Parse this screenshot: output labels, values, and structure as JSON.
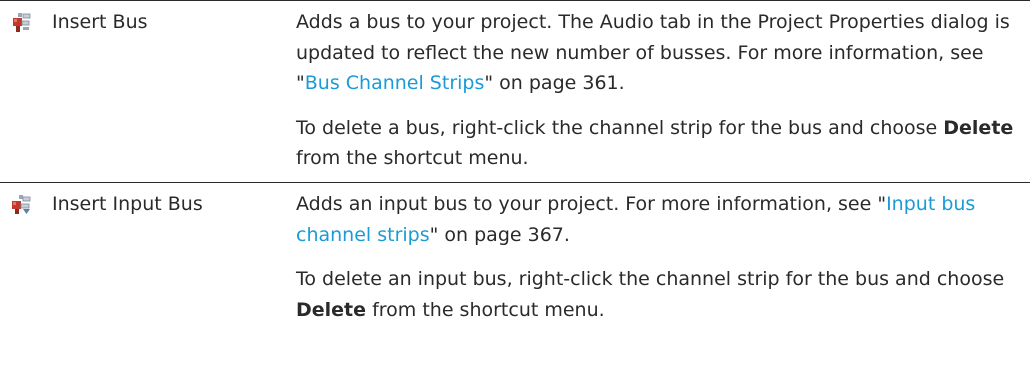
{
  "rows": [
    {
      "icon": "insert-bus-icon",
      "name": "Insert Bus",
      "para1": {
        "before": "Adds a bus to your project. The Audio tab in the Project Properties dialog is updated to reflect the new number of busses. For more information, see \"",
        "link": "Bus Channel Strips",
        "after": "\" on page 361."
      },
      "para2": {
        "before": "To delete a bus, right-click the channel strip for the bus and choose ",
        "command": "Delete",
        "after": " from the shortcut menu."
      }
    },
    {
      "icon": "insert-input-bus-icon",
      "name": "Insert Input Bus",
      "para1": {
        "before": "Adds an input bus to your project. For more information, see \"",
        "link": "Input bus channel strips",
        "after": "\" on page 367."
      },
      "para2": {
        "before": "To delete an input bus, right-click the channel strip for the bus and choose ",
        "command": "Delete",
        "after": " from the shortcut menu."
      }
    }
  ],
  "colors": {
    "text": "#2a2a2a",
    "link": "#1a9bd7",
    "rule": "#2a2a2a"
  }
}
